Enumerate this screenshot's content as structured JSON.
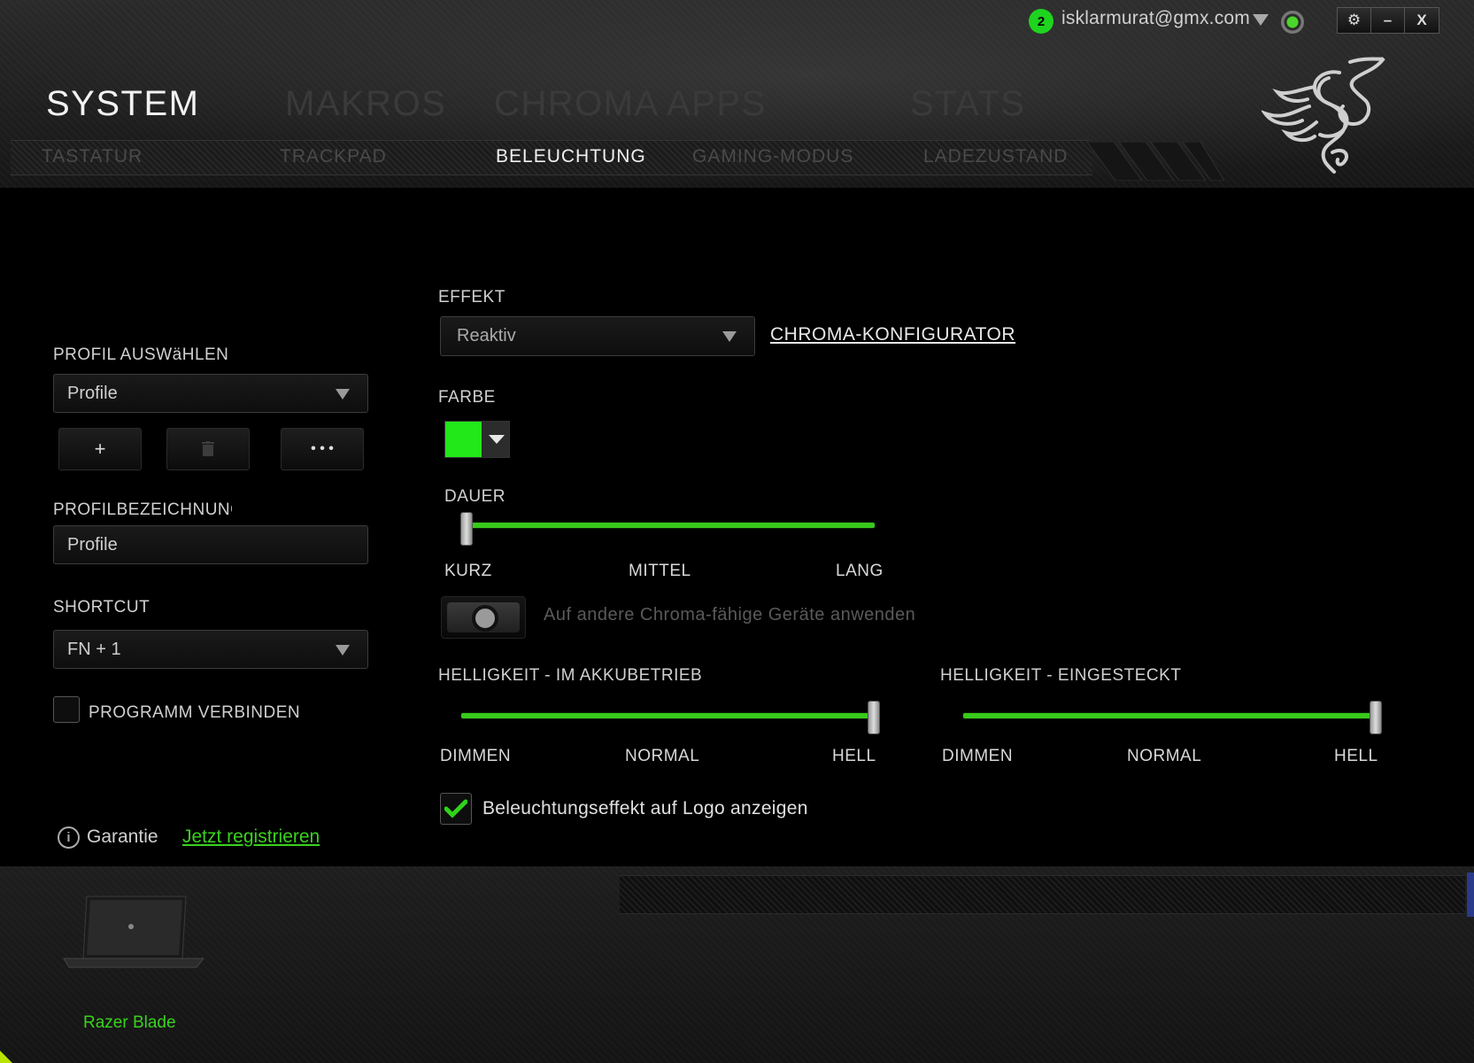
{
  "account": {
    "badge_count": "2",
    "email": "isklarmurat@gmx.com"
  },
  "window_buttons": {
    "settings": "⚙",
    "minimize": "–",
    "close": "X"
  },
  "main_tabs": [
    {
      "label": "SYSTEM",
      "active": true
    },
    {
      "label": "MAKROS",
      "active": false
    },
    {
      "label": "CHROMA APPS",
      "active": false
    },
    {
      "label": "STATS",
      "active": false
    }
  ],
  "sub_tabs": [
    {
      "label": "TASTATUR",
      "active": false
    },
    {
      "label": "TRACKPAD",
      "active": false
    },
    {
      "label": "BELEUCHTUNG",
      "active": true
    },
    {
      "label": "GAMING-MODUS",
      "active": false
    },
    {
      "label": "LADEZUSTAND",
      "active": false
    }
  ],
  "left_panel": {
    "profile_select_label": "PROFIL AUSWäHLEN",
    "profile_select_value": "Profile",
    "add_button": "+",
    "more_button": "• • •",
    "profile_name_label": "PROFILBEZEICHNUNG",
    "profile_name_value": "Profile",
    "shortcut_label": "SHORTCUT",
    "shortcut_value": "FN + 1",
    "link_program_label": "PROGRAMM VERBINDEN",
    "link_program_checked": false,
    "warranty_label": "Garantie",
    "register_link": "Jetzt registrieren"
  },
  "lighting": {
    "effect_label": "EFFEKT",
    "effect_value": "Reaktiv",
    "chroma_configurator": "CHROMA-KONFIGURATOR",
    "color_label": "FARBE",
    "color_value": "#22e81a",
    "duration_label": "DAUER",
    "duration_value": 0.0,
    "duration_ticks": [
      "KURZ",
      "MITTEL",
      "LANG"
    ],
    "apply_other_devices_label": "Auf andere Chroma-fähige Geräte anwenden",
    "apply_other_devices_on": false,
    "brightness_battery_label": "HELLIGKEIT - IM AKKUBETRIEB",
    "brightness_battery_value": 1.0,
    "brightness_plugged_label": "HELLIGKEIT - EINGESTECKT",
    "brightness_plugged_value": 1.0,
    "brightness_ticks": [
      "DIMMEN",
      "NORMAL",
      "HELL"
    ],
    "logo_effect_label": "Beleuchtungseffekt auf Logo anzeigen",
    "logo_effect_checked": true
  },
  "device": {
    "name": "Razer Blade"
  },
  "colors": {
    "accent_green": "#39d21e",
    "inactive_tab": "#3a3a3a"
  }
}
